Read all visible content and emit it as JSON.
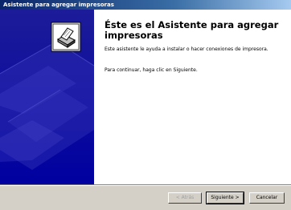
{
  "window": {
    "title": "Asistente para agregar impresoras",
    "colors": {
      "title_bar": "#0a246a",
      "left_panel": "#0000a0",
      "content_bg": "#ffffff",
      "button_bg": "#d4d0c8"
    }
  },
  "wizard": {
    "icon": "printer-icon",
    "heading": "Éste es el Asistente para agregar impresoras",
    "description": "Este asistente le ayuda a instalar o hacer conexiones de impresora.",
    "instruction": "Para continuar, haga clic en Siguiente."
  },
  "buttons": {
    "back": "< Atrás",
    "next": "Siguiente >",
    "cancel": "Cancelar"
  }
}
